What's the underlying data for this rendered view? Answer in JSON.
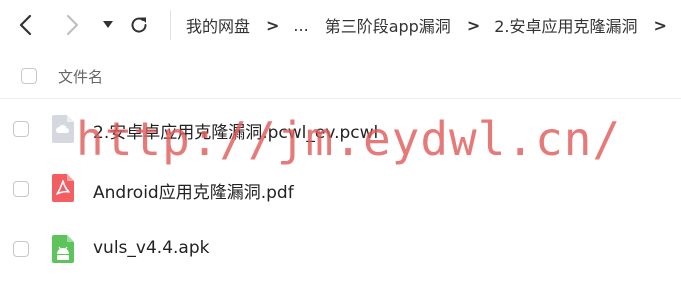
{
  "breadcrumb": {
    "items": [
      "我的网盘",
      "...",
      "第三阶段app漏洞",
      "2.安卓应用克隆漏洞"
    ],
    "separator": ">"
  },
  "file_list": {
    "column_header": "文件名",
    "files": [
      {
        "name": "2.安卓卓应用克隆漏洞.pcwl_ev.pcwl",
        "icon": "generic-file-icon",
        "color": "#c9cdd4"
      },
      {
        "name": "Android应用克隆漏洞.pdf",
        "icon": "pdf-icon",
        "color": "#f25e62"
      },
      {
        "name": "vuls_v4.4.apk",
        "icon": "apk-icon",
        "color": "#5cc45a"
      }
    ]
  },
  "watermark": {
    "text": "http://jm.eydwl.cn/"
  },
  "colors": {
    "watermark": "#e25c5c"
  }
}
